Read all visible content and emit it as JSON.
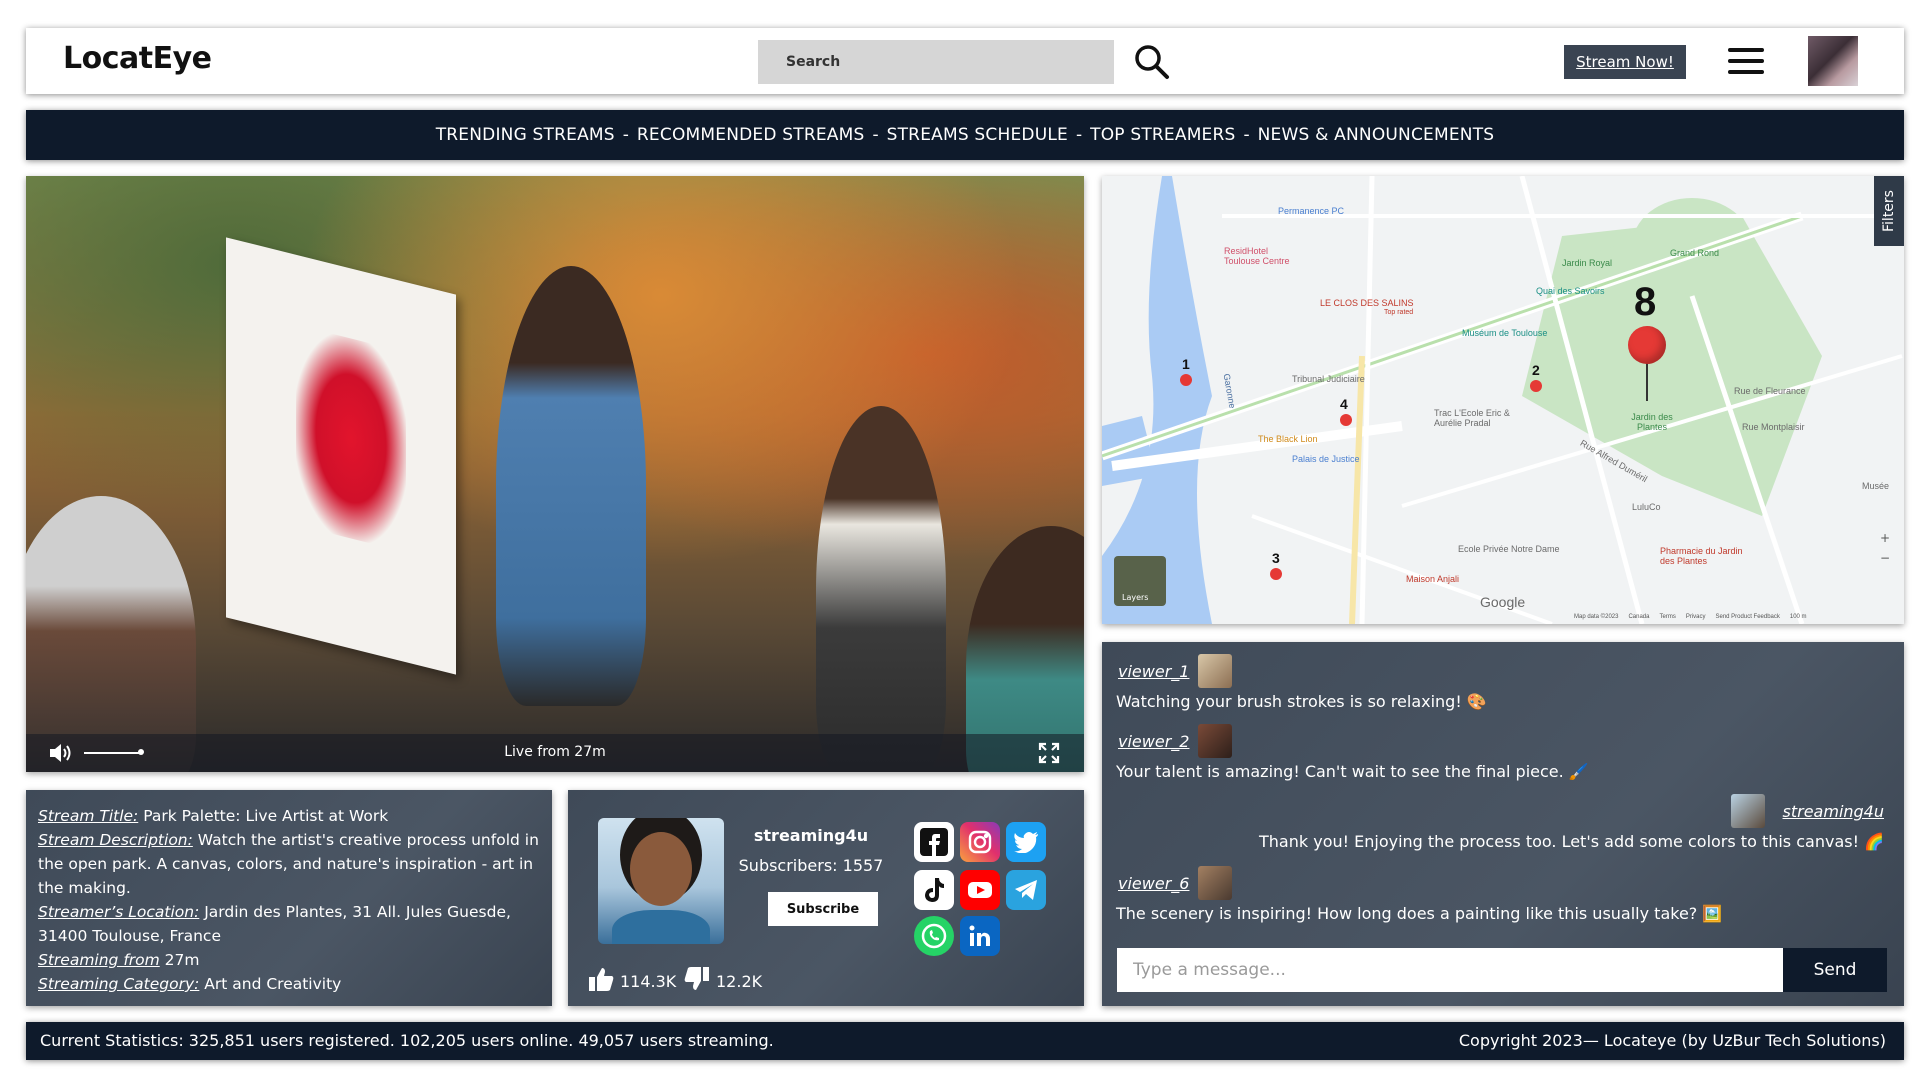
{
  "header": {
    "logo": "LocatEye",
    "search_placeholder": "Search",
    "stream_now": "Stream Now!"
  },
  "nav": {
    "items": [
      "TRENDING STREAMS",
      "RECOMMENDED STREAMS",
      "STREAMS SCHEDULE",
      "TOP STREAMERS",
      "NEWS & ANNOUNCEMENTS"
    ],
    "separator": "-"
  },
  "video": {
    "live_text": "Live from 27m"
  },
  "map": {
    "filters_label": "Filters",
    "pins": [
      "1",
      "2",
      "3",
      "4",
      "8"
    ],
    "places": [
      "Permanence PC",
      "ResidHotel Toulouse Centre",
      "LE CLOS DES SALINS",
      "Top rated",
      "Jardin Royal",
      "Grand Rond",
      "Quai des Savoirs",
      "Muséum de Toulouse",
      "Tribunal Judiciaire",
      "Trac L'Ecole Eric & Aurélie Pradal",
      "The Black Lion",
      "Palais de Justice",
      "Jardin des Plantes",
      "Ecole Privée Notre Dame",
      "Maison Anjali",
      "Pharmacie du Jardin des Plantes",
      "LuluCo",
      "Garonne",
      "Rue de Fleurance",
      "Rue Montplaisir",
      "Rue Alfred Duméril",
      "Layers",
      "Google",
      "Map data ©2023",
      "Canada",
      "Terms",
      "Privacy",
      "Send Product Feedback",
      "100 m",
      "Musée"
    ]
  },
  "info": {
    "title_label": "Stream Title:",
    "title_value": " Park Palette: Live Artist at Work",
    "description_label": "Stream Description:",
    "description_value": " Watch the artist's creative process unfold in the open park. A canvas, colors, and nature's inspiration - art in the making.",
    "location_label": "Streamer’s Location:",
    "location_value": " Jardin des Plantes, 31 All. Jules Guesde, 31400 Toulouse, France",
    "from_label": "Streaming from",
    "from_value": " 27m",
    "category_label": "Streaming Category:",
    "category_value": " Art and Creativity"
  },
  "streamer": {
    "name": "streaming4u",
    "subscribers": "Subscribers: 1557",
    "subscribe_label": "Subscribe",
    "likes": "114.3K",
    "dislikes": "12.2K",
    "socials": [
      "facebook",
      "instagram",
      "twitter",
      "tiktok",
      "youtube",
      "telegram",
      "whatsapp",
      "linkedin"
    ],
    "colors": {
      "facebook": "#ffffff",
      "instagram": "#e1306c",
      "twitter": "#1da1f2",
      "tiktok": "#ffffff",
      "youtube": "#ff0000",
      "telegram": "#2aa3df",
      "whatsapp": "#25d366",
      "linkedin": "#0a66c2"
    }
  },
  "chat": {
    "messages": [
      {
        "user": "viewer_1",
        "text": "Watching your brush strokes is so relaxing! 🎨"
      },
      {
        "user": "viewer_2",
        "text": "Your talent is amazing! Can't wait to see the final piece. 🖌️"
      },
      {
        "user": "streaming4u",
        "text": "Thank you! Enjoying the process too. Let's add some colors to this canvas! 🌈"
      },
      {
        "user": "viewer_6",
        "text": "The scenery is inspiring! How long does a painting like this usually take? 🖼️"
      }
    ],
    "input_placeholder": "Type a message...",
    "send_label": "Send"
  },
  "footer": {
    "stats": "Current Statistics: 325,851 users registered. 102,205 users online. 49,057 users streaming.",
    "copyright": "Copyright 2023— Locateye (by UzBur Tech Solutions)"
  }
}
